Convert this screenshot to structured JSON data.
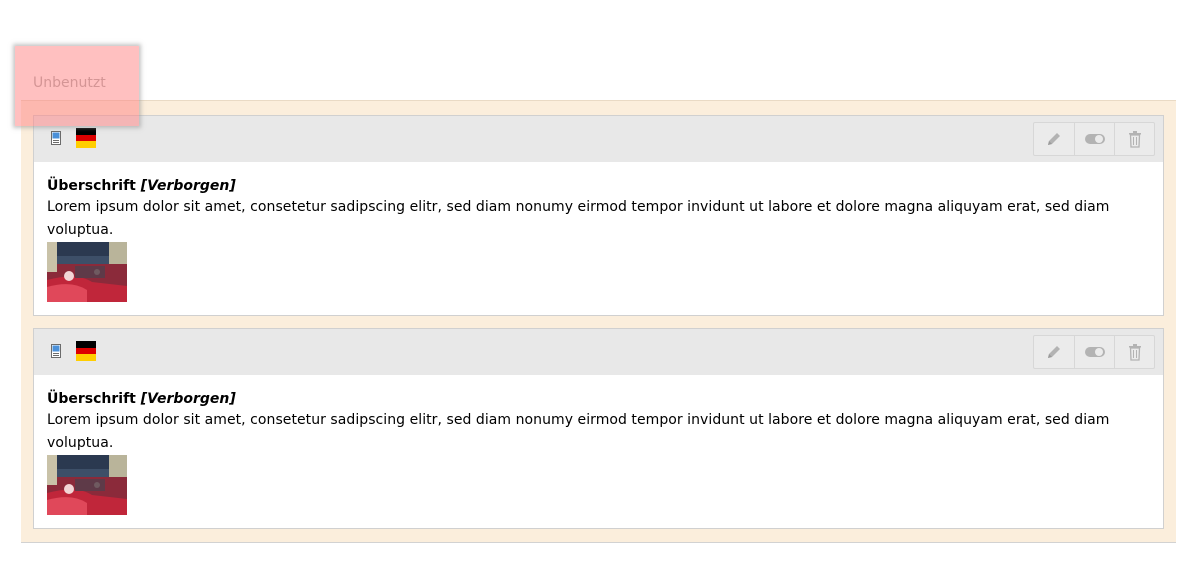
{
  "section": {
    "tab_label": "Unbenutzt"
  },
  "elements": [
    {
      "language_flag": "de-flag",
      "type_icon": "text-media-icon",
      "title": "Überschrift",
      "hidden_label": "[Verborgen]",
      "text": "Lorem ipsum dolor sit amet, consetetur sadipscing elitr, sed diam nonumy eirmod tempor invidunt ut labore et dolore magna aliquyam erat, sed diam voluptua.",
      "actions": [
        "pencil-icon",
        "toggle-icon",
        "trash-icon"
      ]
    },
    {
      "language_flag": "de-flag",
      "type_icon": "text-media-icon",
      "title": "Überschrift",
      "hidden_label": "[Verborgen]",
      "text": "Lorem ipsum dolor sit amet, consetetur sadipscing elitr, sed diam nonumy eirmod tempor invidunt ut labore et dolore magna aliquyam erat, sed diam voluptua.",
      "actions": [
        "pencil-icon",
        "toggle-icon",
        "trash-icon"
      ]
    }
  ],
  "colors": {
    "column_bg": "#fbeedc",
    "header_bg": "#e8e8e8",
    "highlight": "#ff8282"
  }
}
